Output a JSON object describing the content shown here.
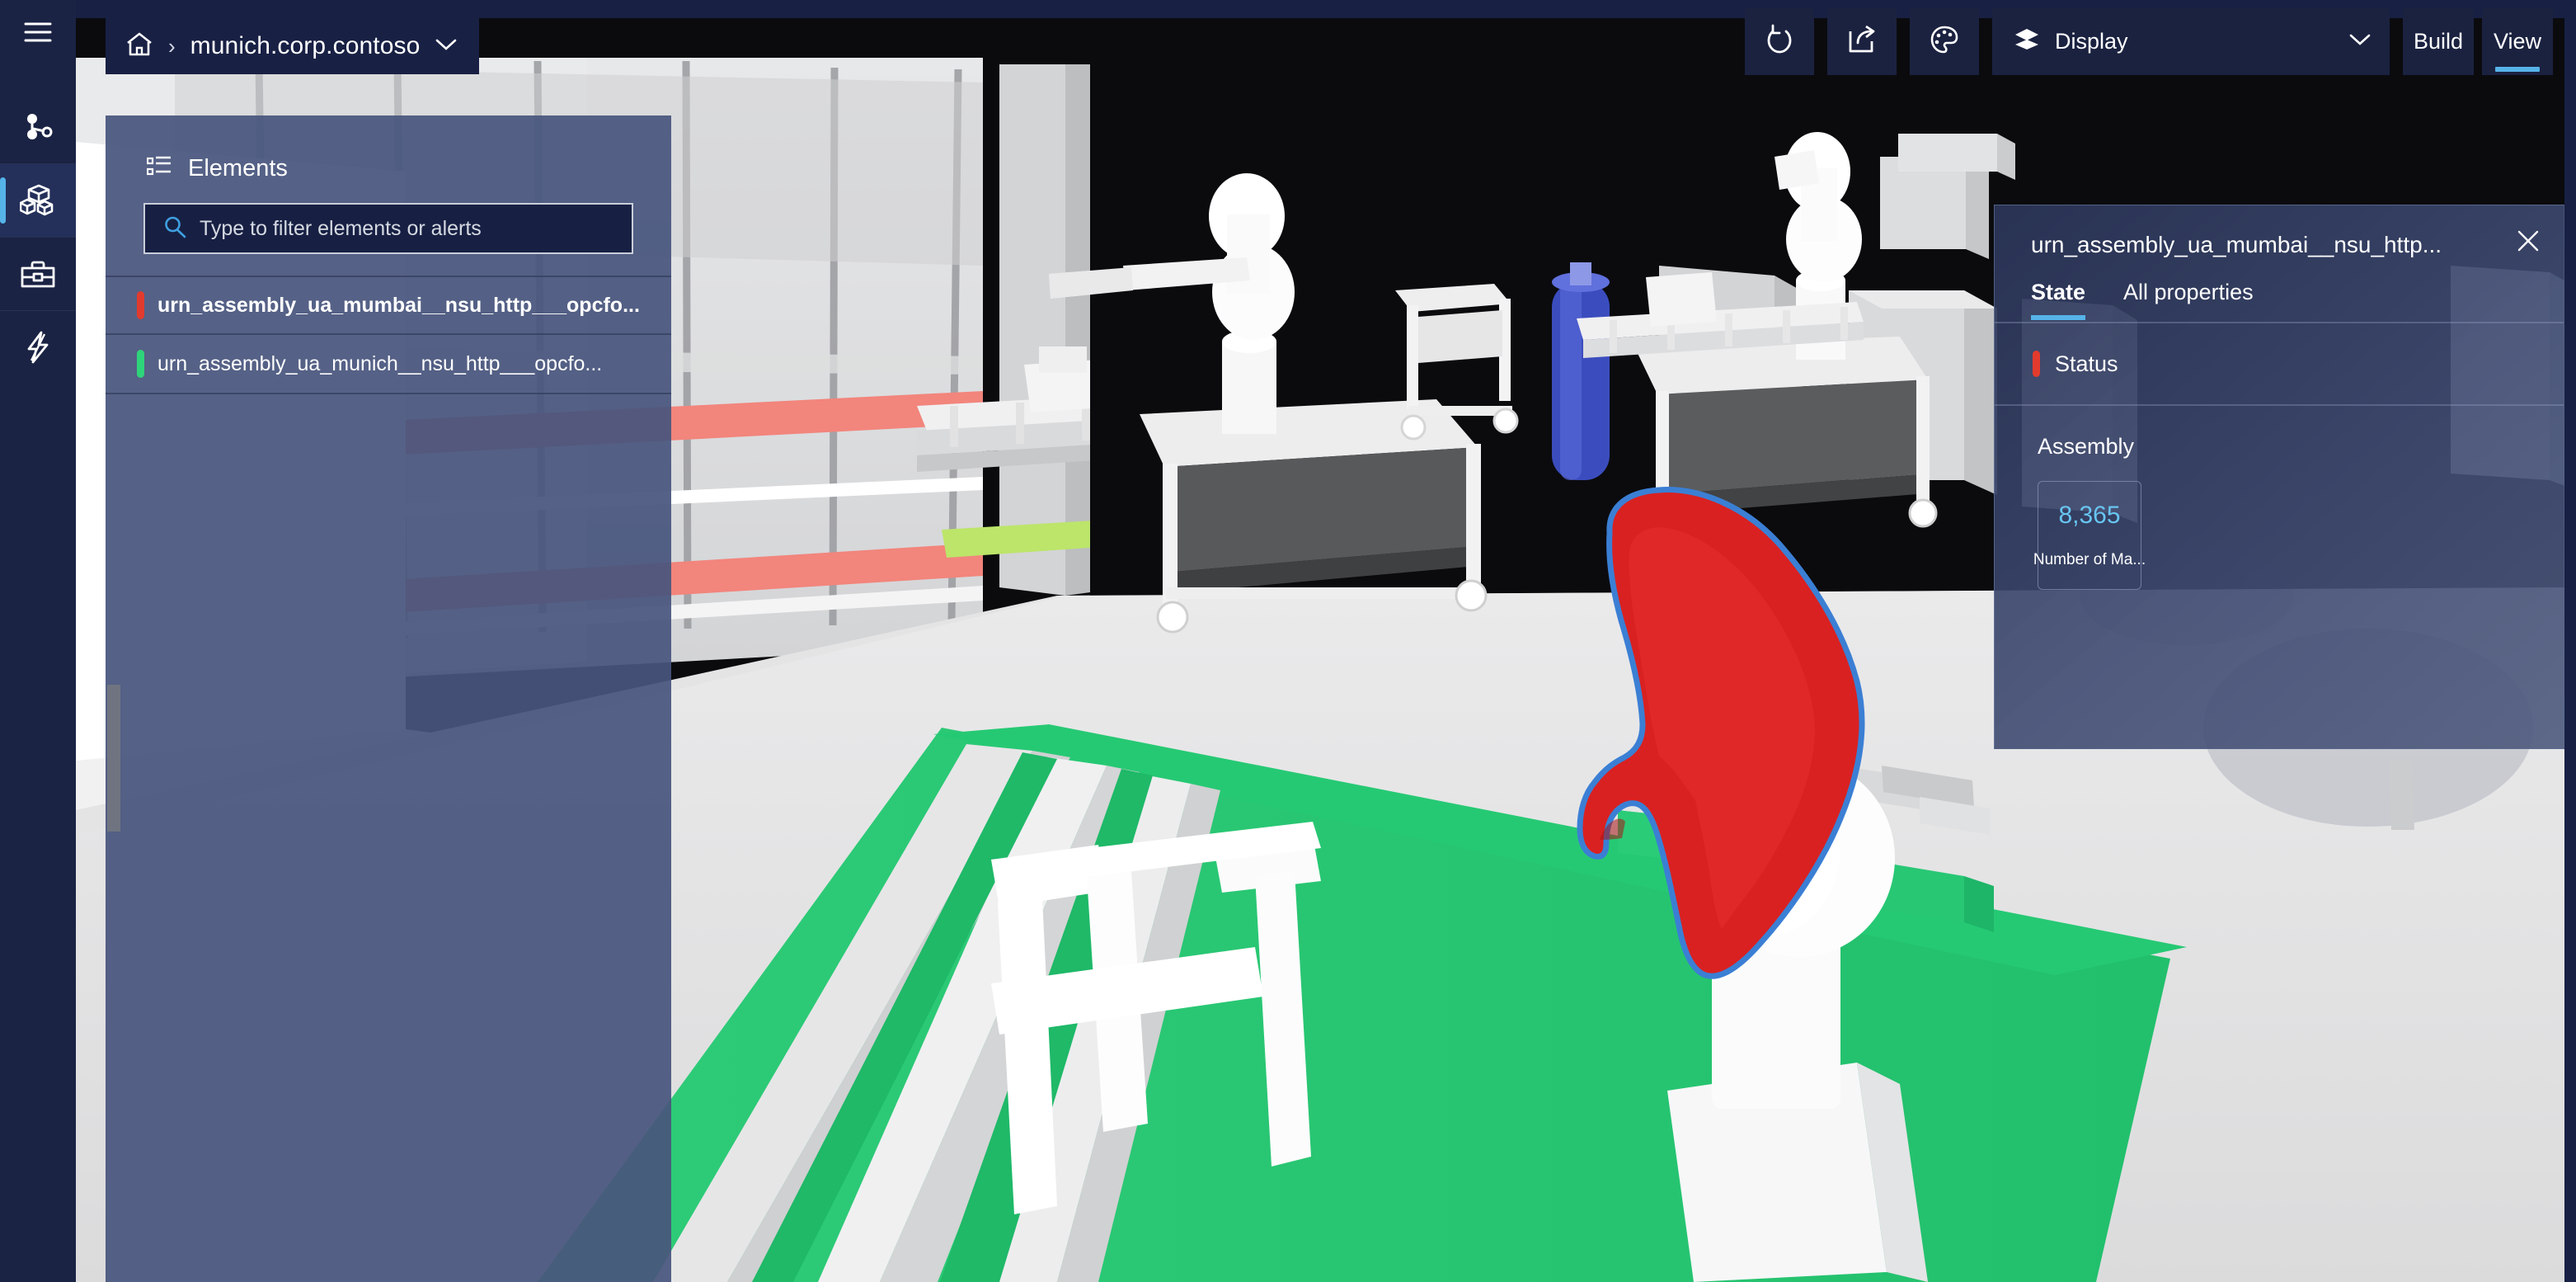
{
  "rail": {
    "items": [
      {
        "name": "hamburger-menu",
        "icon": "hamburger-icon",
        "active": false
      },
      {
        "name": "topology",
        "icon": "graph-node-icon",
        "active": false
      },
      {
        "name": "scenes",
        "icon": "boxes-3d-icon",
        "active": true
      },
      {
        "name": "tools",
        "icon": "toolbox-icon",
        "active": false
      },
      {
        "name": "power",
        "icon": "lightning-bolt-icon",
        "active": false
      }
    ]
  },
  "breadcrumb": {
    "home_icon": "home-icon",
    "separator": "›",
    "label": "munich.corp.contoso",
    "chevron_icon": "chevron-down-icon"
  },
  "toolbar": {
    "refresh_icon": "refresh-icon",
    "share_icon": "share-icon",
    "theme_icon": "palette-icon",
    "display": {
      "icon": "layers-icon",
      "label": "Display",
      "chevron_icon": "chevron-down-icon"
    },
    "build_label": "Build",
    "view_label": "View",
    "active_tab": "View"
  },
  "elements_panel": {
    "icon": "list-filter-icon",
    "title": "Elements",
    "search": {
      "icon": "search-icon",
      "placeholder": "Type to filter elements or alerts",
      "value": ""
    },
    "items": [
      {
        "label": "urn_assembly_ua_mumbai__nsu_http___opcfo...",
        "status_color": "#e23b2e",
        "selected": true
      },
      {
        "label": "urn_assembly_ua_munich__nsu_http___opcfo...",
        "status_color": "#2ed47a",
        "selected": false
      }
    ]
  },
  "properties_panel": {
    "title": "urn_assembly_ua_mumbai__nsu_http...",
    "close_icon": "close-icon",
    "tabs": [
      {
        "label": "State",
        "active": true
      },
      {
        "label": "All properties",
        "active": false
      }
    ],
    "status": {
      "label": "Status",
      "color": "#e23b2e"
    },
    "section": {
      "title": "Assembly",
      "cards": [
        {
          "value": "8,365",
          "label": "Number of Ma...",
          "value_color": "#68c5f0"
        }
      ]
    }
  },
  "colors": {
    "rail_bg": "#1b2344",
    "topbar_bg": "#182044",
    "accent_blue": "#56b3e8",
    "panel_bg": "#48557d",
    "toolbar_btn_bg": "#1b2240",
    "status_red": "#e23b2e",
    "status_green": "#2ed47a",
    "conveyor_green": "#2ecc78",
    "selected_part_red": "#d92121",
    "selection_outline": "#3b7fd4"
  },
  "scene": {
    "name": "factory-floor-3d-scene",
    "description": "3D factory viewport"
  }
}
